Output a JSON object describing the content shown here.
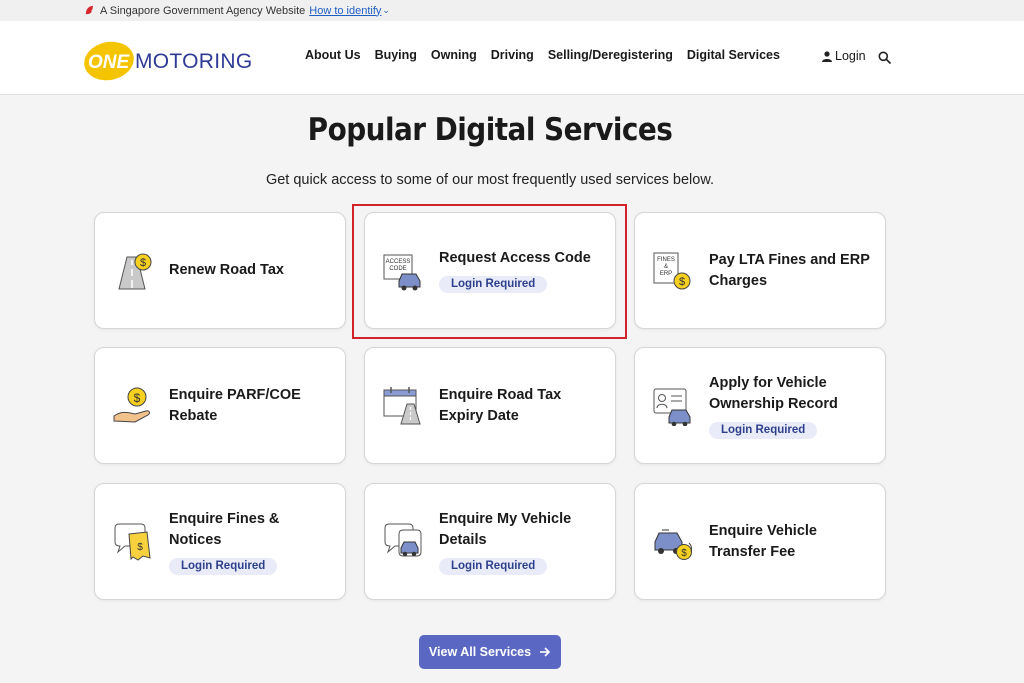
{
  "gov_bar": {
    "text": "A Singapore Government Agency Website",
    "identify_link": "How to identify"
  },
  "logo": {
    "one": "ONE",
    "motoring": "MOTORING"
  },
  "nav": {
    "items": [
      "About Us",
      "Buying",
      "Owning",
      "Driving",
      "Selling/Deregistering",
      "Digital Services"
    ],
    "login": "Login"
  },
  "main": {
    "title": "Popular Digital Services",
    "subtitle": "Get quick access to some of our most frequently used services below."
  },
  "services": [
    {
      "title": "Renew Road Tax",
      "badge": "",
      "icon": "road-coin-icon"
    },
    {
      "title": "Request Access Code",
      "badge": "Login Required",
      "icon": "access-code-icon",
      "icon_text": [
        "ACCESS",
        "CODE"
      ]
    },
    {
      "title": "Pay LTA Fines and ERP Charges",
      "badge": "",
      "icon": "fines-erp-icon",
      "icon_text": [
        "FINES",
        "&",
        "ERP"
      ]
    },
    {
      "title": "Enquire PARF/COE Rebate",
      "badge": "",
      "icon": "hand-coin-icon"
    },
    {
      "title": "Enquire Road Tax Expiry Date",
      "badge": "",
      "icon": "calendar-road-icon"
    },
    {
      "title": "Apply for Vehicle Ownership Record",
      "badge": "Login Required",
      "icon": "id-card-car-icon"
    },
    {
      "title": "Enquire Fines & Notices",
      "badge": "Login Required",
      "icon": "chat-receipt-icon"
    },
    {
      "title": "Enquire My Vehicle Details",
      "badge": "Login Required",
      "icon": "chat-car-icon"
    },
    {
      "title": "Enquire Vehicle Transfer Fee",
      "badge": "",
      "icon": "car-transfer-coin-icon"
    }
  ],
  "view_all": "View All Services",
  "colors": {
    "accent": "#5a68c3",
    "logo_yellow": "#f5c400",
    "logo_blue": "#2f3b96",
    "badge_bg": "#e9ecf8",
    "badge_text": "#2e3f8c",
    "highlight": "#d0232a"
  }
}
